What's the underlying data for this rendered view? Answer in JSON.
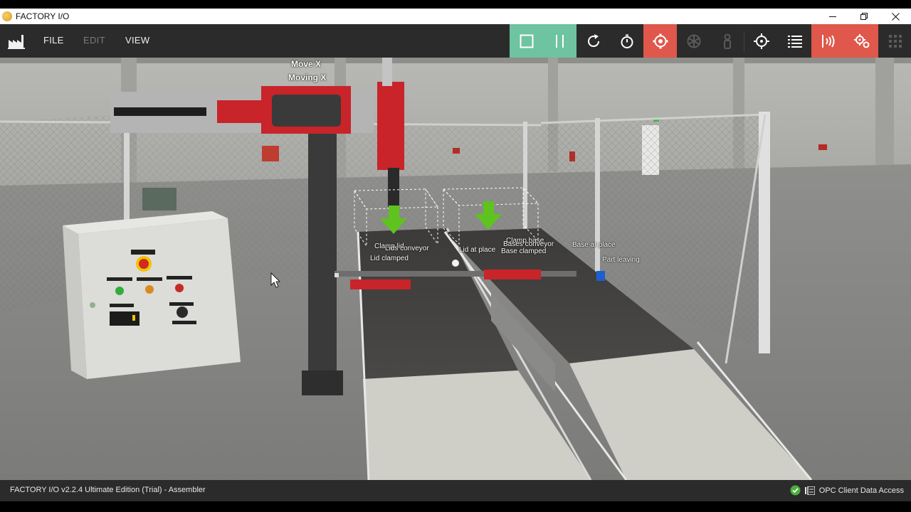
{
  "window": {
    "title": "FACTORY I/O",
    "controls": [
      "minimize",
      "restore",
      "close"
    ]
  },
  "menu": {
    "file": "FILE",
    "edit": "EDIT",
    "view": "VIEW",
    "edit_enabled": false
  },
  "toolbar": {
    "items": [
      {
        "icon": "stop-square-icon",
        "state": "active-green"
      },
      {
        "icon": "pause-icon",
        "state": "active-green"
      },
      {
        "icon": "reset-icon",
        "state": "normal"
      },
      {
        "icon": "stopwatch-icon",
        "state": "normal"
      },
      {
        "icon": "camera-orbit-icon",
        "state": "active-red"
      },
      {
        "icon": "fly-camera-icon",
        "state": "disabled"
      },
      {
        "icon": "first-person-icon",
        "state": "disabled"
      },
      {
        "icon": "crosshair-icon",
        "state": "normal"
      },
      {
        "icon": "list-icon",
        "state": "normal"
      },
      {
        "icon": "sensor-icon",
        "state": "active-red"
      },
      {
        "icon": "drivers-gear-icon",
        "state": "active-red"
      },
      {
        "icon": "grid-icon",
        "state": "disabled"
      }
    ],
    "colors": {
      "green": "#6ec3a0",
      "red": "#e0574b",
      "bar": "#2b2b2b"
    }
  },
  "scene": {
    "labels": {
      "move_x": "Move X",
      "moving_x": "Moving X",
      "clamp_lid": "Clamp lid",
      "lids_conveyor": "Lids conveyor",
      "lid_clamped": "Lid clamped",
      "lid_at_place": "Lid at place",
      "clamp_base": "Clamp base",
      "bases_conveyor": "Bases conveyor",
      "base_clamped": "Base clamped",
      "base_at_place": "Base at place",
      "part_leaving": "Part leaving"
    },
    "arrow_color": "#5ec31e",
    "machine_red": "#c8242a"
  },
  "status": {
    "version": "FACTORY I/O v2.2.4 Ultimate Edition (Trial)  - Assembler",
    "driver": "OPC Client Data Access",
    "driver_ok": true
  }
}
